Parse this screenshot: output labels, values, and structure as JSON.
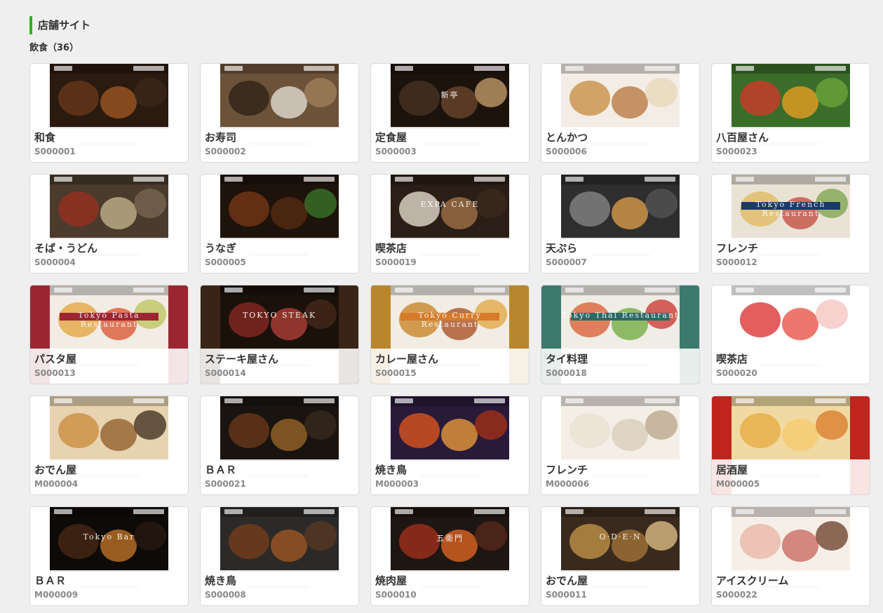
{
  "section_title": "店舗サイト",
  "category_title": "飲食（36）",
  "cards": [
    {
      "name": "和食",
      "code": "S000001",
      "theme": "washoku",
      "thumb_text": ""
    },
    {
      "name": "お寿司",
      "code": "S000002",
      "theme": "sushi",
      "thumb_text": ""
    },
    {
      "name": "定食屋",
      "code": "S000003",
      "theme": "teishoku",
      "thumb_text": "新亭"
    },
    {
      "name": "とんかつ",
      "code": "S000006",
      "theme": "tonkatsu",
      "thumb_text": ""
    },
    {
      "name": "八百屋さん",
      "code": "S000023",
      "theme": "yaoya",
      "thumb_text": ""
    },
    {
      "name": "そば・うどん",
      "code": "S000004",
      "theme": "soba",
      "thumb_text": ""
    },
    {
      "name": "うなぎ",
      "code": "S000005",
      "theme": "unagi",
      "thumb_text": ""
    },
    {
      "name": "喫茶店",
      "code": "S000019",
      "theme": "kissa",
      "thumb_text": "EXPA CAFE"
    },
    {
      "name": "天ぷら",
      "code": "S000007",
      "theme": "tempura",
      "thumb_text": ""
    },
    {
      "name": "フレンチ",
      "code": "S000012",
      "theme": "french",
      "thumb_text": "Tokyo French Restaurant"
    },
    {
      "name": "パスタ屋",
      "code": "S000013",
      "theme": "pasta",
      "thumb_text": "Tokyo Pasta Restaurant"
    },
    {
      "name": "ステーキ屋さん",
      "code": "S000014",
      "theme": "steak",
      "thumb_text": "TOKYO STEAK"
    },
    {
      "name": "カレー屋さん",
      "code": "S000015",
      "theme": "curry",
      "thumb_text": "Tokyo Curry Restaurant"
    },
    {
      "name": "タイ料理",
      "code": "S000018",
      "theme": "thai",
      "thumb_text": "Tokyo Thai Restaurant"
    },
    {
      "name": "喫茶店",
      "code": "S000020",
      "theme": "cafe",
      "thumb_text": ""
    },
    {
      "name": "おでん屋",
      "code": "M000004",
      "theme": "oden",
      "thumb_text": ""
    },
    {
      "name": "ＢＡＲ",
      "code": "S000021",
      "theme": "bar",
      "thumb_text": ""
    },
    {
      "name": "焼き鳥",
      "code": "M000003",
      "theme": "yakitori",
      "thumb_text": ""
    },
    {
      "name": "フレンチ",
      "code": "M000006",
      "theme": "french2",
      "thumb_text": ""
    },
    {
      "name": "居酒屋",
      "code": "M000005",
      "theme": "izakaya",
      "thumb_text": ""
    },
    {
      "name": "ＢＡＲ",
      "code": "M000009",
      "theme": "bar2",
      "thumb_text": "Tokyo Bar"
    },
    {
      "name": "焼き鳥",
      "code": "S000008",
      "theme": "yakitori2",
      "thumb_text": ""
    },
    {
      "name": "焼肉屋",
      "code": "S000010",
      "theme": "yakiniku",
      "thumb_text": "五衛門"
    },
    {
      "name": "おでん屋",
      "code": "S000011",
      "theme": "oden2",
      "thumb_text": "O·D·E·N"
    },
    {
      "name": "アイスクリーム",
      "code": "S000022",
      "theme": "icecream",
      "thumb_text": ""
    }
  ]
}
